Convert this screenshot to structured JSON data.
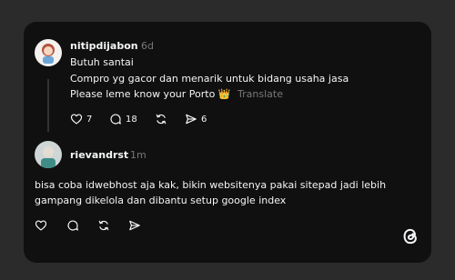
{
  "post": {
    "username": "nitipdijabon",
    "time": "6d",
    "lines": [
      "Butuh santai",
      "Compro yg gacor dan menarik untuk bidang usaha jasa",
      "Please leme know your Porto 👑"
    ],
    "translate_label": "Translate",
    "likes": "7",
    "comments": "18",
    "shares": "6"
  },
  "reply": {
    "username": "rievandrst",
    "time": "1m",
    "lines": [
      "bisa coba idwebhost aja kak, bikin websitenya pakai sitepad jadi lebih",
      "gampang dikelola dan dibantu setup google index"
    ]
  },
  "icons": {
    "like": "heart-icon",
    "comment": "comment-icon",
    "repost": "repost-icon",
    "share": "send-icon",
    "logo": "threads-logo-icon"
  },
  "colors": {
    "background": "#2b2b2b",
    "card": "#101010",
    "text": "#f3f5f7",
    "muted": "#777777"
  }
}
